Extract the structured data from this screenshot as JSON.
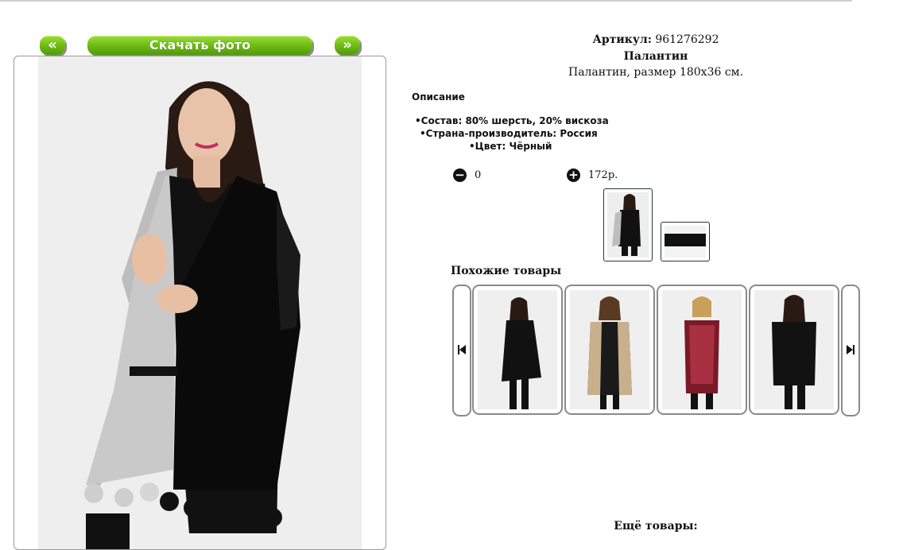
{
  "nav": {
    "prev_label": "«",
    "download_label": "Скачать фото",
    "next_label": "»"
  },
  "product": {
    "article_label": "Артикул:",
    "article_value": "961276292",
    "title": "Палантин",
    "subtitle": "Палантин, размер 180x36 см.",
    "description_heading": "Описание",
    "features": [
      "Состав: 80% шерсть, 20% вискоза",
      "Страна-производитель: Россия",
      "Цвет: Чёрный"
    ]
  },
  "quantity": {
    "minus_icon": "minus-circle-icon",
    "value": "0",
    "plus_icon": "plus-circle-icon",
    "price": "172р."
  },
  "similar": {
    "heading": "Похожие товары",
    "prev_icon": "skip-back-icon",
    "next_icon": "skip-forward-icon"
  },
  "more": {
    "heading": "Ещё товары:"
  },
  "colors": {
    "button_green": "#6fbd14",
    "border_gray": "#8a8a8a"
  }
}
